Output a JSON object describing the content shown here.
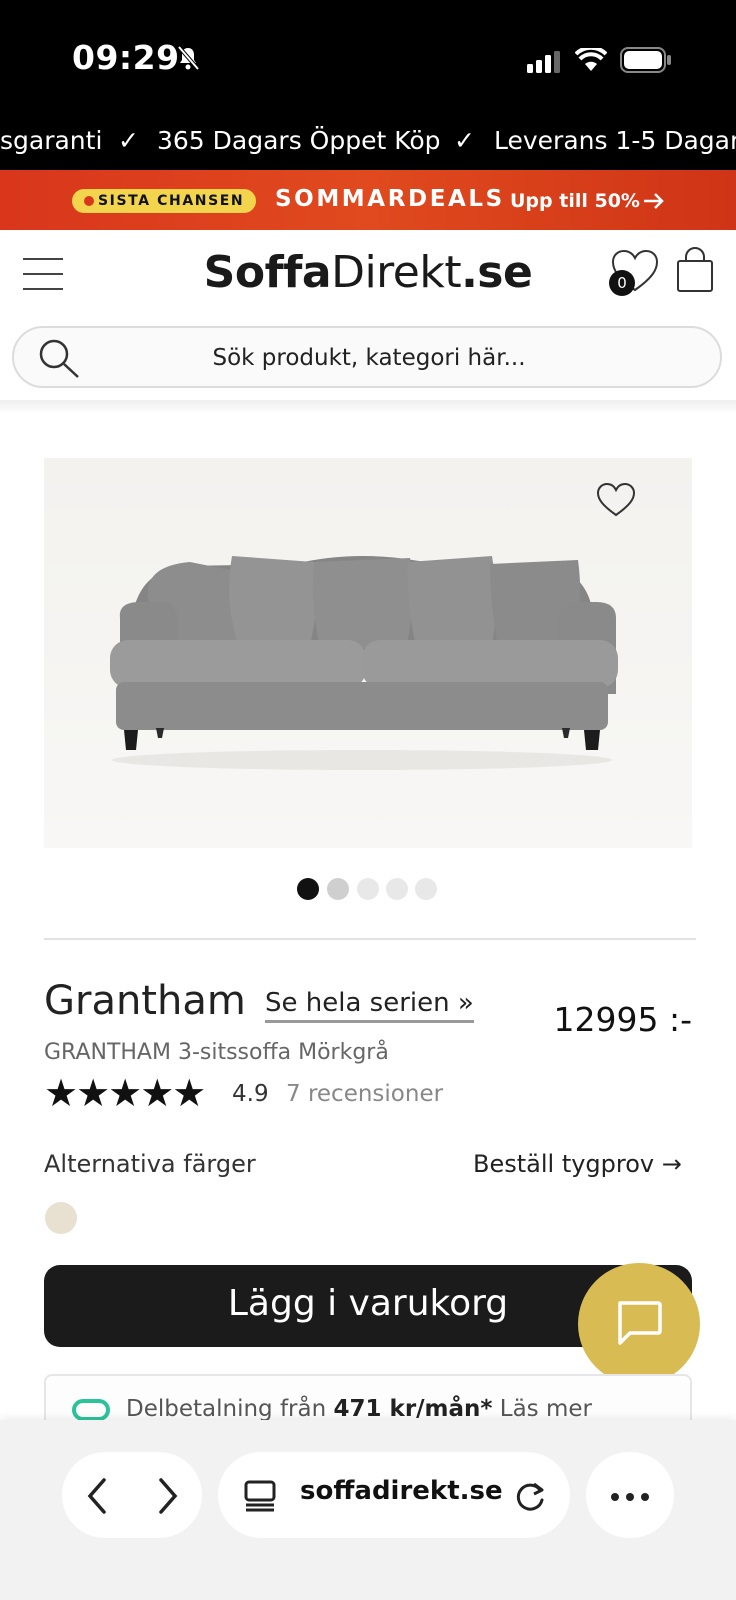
{
  "status_bar": {
    "time": "09:29"
  },
  "usp": [
    "sgaranti",
    "365 Dagars Öppet Köp",
    "Leverans 1-5 Dagar"
  ],
  "promo": {
    "badge": "SISTA CHANSEN",
    "title": "SOMMARDEALS",
    "sub": "Upp till 50%"
  },
  "header": {
    "logo_bold": "Soffa",
    "logo_regular": "Direkt",
    "logo_tld": ".se",
    "wishlist_count": "0"
  },
  "search": {
    "placeholder": "Sök produkt, kategori här..."
  },
  "carousel": {
    "count": 5,
    "active": 0
  },
  "product": {
    "name": "Grantham",
    "series_link": "Se hela serien »",
    "price": "12995 :-",
    "subtitle": "GRANTHAM 3-sitssoffa Mörkgrå",
    "stars": "★★★★★",
    "rating": "4.9",
    "reviews": "7 recensioner",
    "alt_colors_label": "Alternativa färger",
    "order_sample": "Beställ tygprov →",
    "swatch_color": "#e8e1d2",
    "add_to_cart": "Lägg i varukorg"
  },
  "payment": {
    "prefix": "Delbetalning från",
    "amount": "471 kr/mån*",
    "more": "Läs mer"
  },
  "browser": {
    "url": "soffadirekt.se"
  },
  "colors": {
    "promo": "#d9361c",
    "badge": "#f2d44d",
    "chat": "#d9bb54",
    "cart": "#1b1b1b"
  }
}
